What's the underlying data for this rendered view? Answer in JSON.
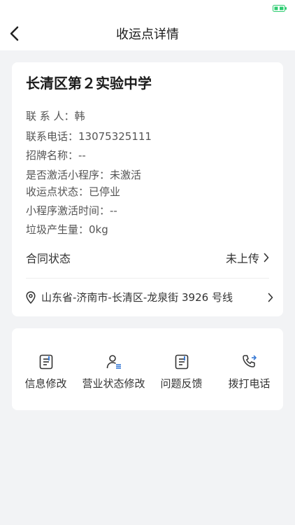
{
  "nav": {
    "title": "收运点详情"
  },
  "school": {
    "name": "长清区第２实验中学"
  },
  "info": {
    "contact": "联 系 人：韩",
    "phone": "联系电话：13075325111",
    "sign_name": "招牌名称：--",
    "mini_program_activated": "是否激活小程序：未激活",
    "point_status": "收运点状态：已停业",
    "activation_time": "小程序激活时间：--",
    "garbage_amount": "垃圾产生量：0kg"
  },
  "contract": {
    "label": "合同状态",
    "status": "未上传"
  },
  "address": {
    "text": "山东省-济南市-长清区-龙泉街 3926 号线"
  },
  "actions": [
    {
      "label": "信息修改",
      "icon": "edit-doc-icon"
    },
    {
      "label": "营业状态修改",
      "icon": "user-list-icon"
    },
    {
      "label": "问题反馈",
      "icon": "feedback-doc-icon"
    },
    {
      "label": "拨打电话",
      "icon": "phone-call-icon"
    }
  ],
  "colors": {
    "accent": "#3a7bd5",
    "battery": "#2ecc71"
  }
}
